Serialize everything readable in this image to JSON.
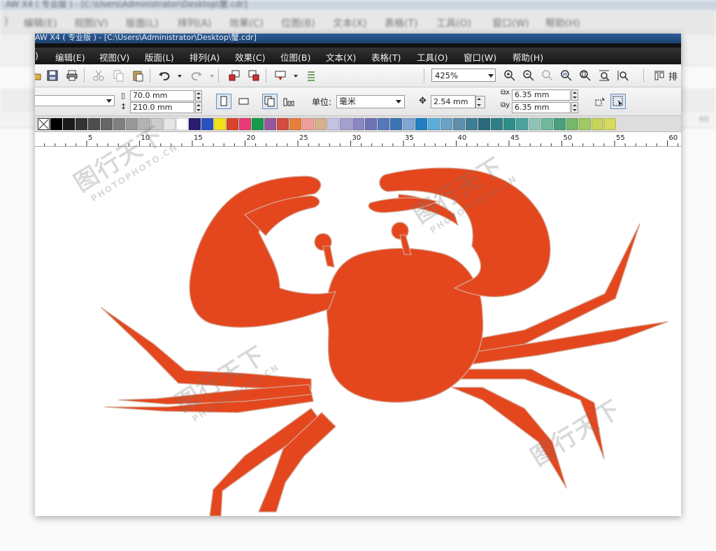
{
  "background_app": {
    "title": "AW X4 ( 专业版 ) - [C:\\Users\\Administrator\\Desktop\\蟹.cdr]",
    "menu": [
      "编辑(E)",
      "视图(V)",
      "版面(L)",
      "排列(A)",
      "效果(C)",
      "位图(B)",
      "文本(X)",
      "表格(T)",
      "工具(O)",
      "窗口(W)",
      "帮助(H)"
    ],
    "ruler_label": "60"
  },
  "window": {
    "title": "AW X4 ( 专业版 ) - [C:\\Users\\Administrator\\Desktop\\蟹.cdr]",
    "menu": {
      "m0": "",
      "edit": "编辑(E)",
      "view": "视图(V)",
      "layout": "版面(L)",
      "arrange": "排列(A)",
      "effects": "效果(C)",
      "bitmaps": "位图(B)",
      "text": "文本(X)",
      "table": "表格(T)",
      "tools": "工具(O)",
      "window": "窗口(W)",
      "help": "帮助(H)"
    },
    "toolbar": {
      "zoom_level": "425%",
      "align_label": "排"
    },
    "property_bar": {
      "page_width": "70.0 mm",
      "page_height": "210.0 mm",
      "units_label": "单位:",
      "units_value": "毫米",
      "nudge": "2.54 mm",
      "dup_x": "6.35 mm",
      "dup_y": "6.35 mm"
    },
    "palette": [
      "#000000",
      "#1a1a1a",
      "#333333",
      "#4d4d4d",
      "#666666",
      "#808080",
      "#999999",
      "#b3b3b3",
      "#cccccc",
      "#e6e6e6",
      "#ffffff",
      "#2b1d6e",
      "#2a52be",
      "#f2e01c",
      "#d9442a",
      "#e63b74",
      "#159a4a",
      "#97569f",
      "#d24d3c",
      "#e97e3a",
      "#ef9f9b",
      "#d8b08c",
      "#c4c4e4",
      "#a3a0d2",
      "#8b86c4",
      "#6c73b4",
      "#5678b8",
      "#3c73b5",
      "#83a5d3",
      "#1f7fc2",
      "#5aaedc",
      "#6ba3c6",
      "#5e8fa8",
      "#3f7f96",
      "#2b6a7a",
      "#307f86",
      "#2d8e8a",
      "#4aa29d",
      "#8fc5b8",
      "#6fb89b",
      "#4aa07a",
      "#78b86a",
      "#a2c864",
      "#c6d45a",
      "#d7db5e"
    ],
    "ruler_labels": [
      "5",
      "10",
      "15",
      "20",
      "25",
      "30",
      "35",
      "40",
      "45",
      "50",
      "55",
      "60"
    ],
    "canvas": {
      "shape_color": "#e4471e",
      "shape": "crab-silhouette"
    }
  },
  "watermark": {
    "brand_cn": "图行天下",
    "brand_en": "PHOTOPHOTO.CN"
  }
}
